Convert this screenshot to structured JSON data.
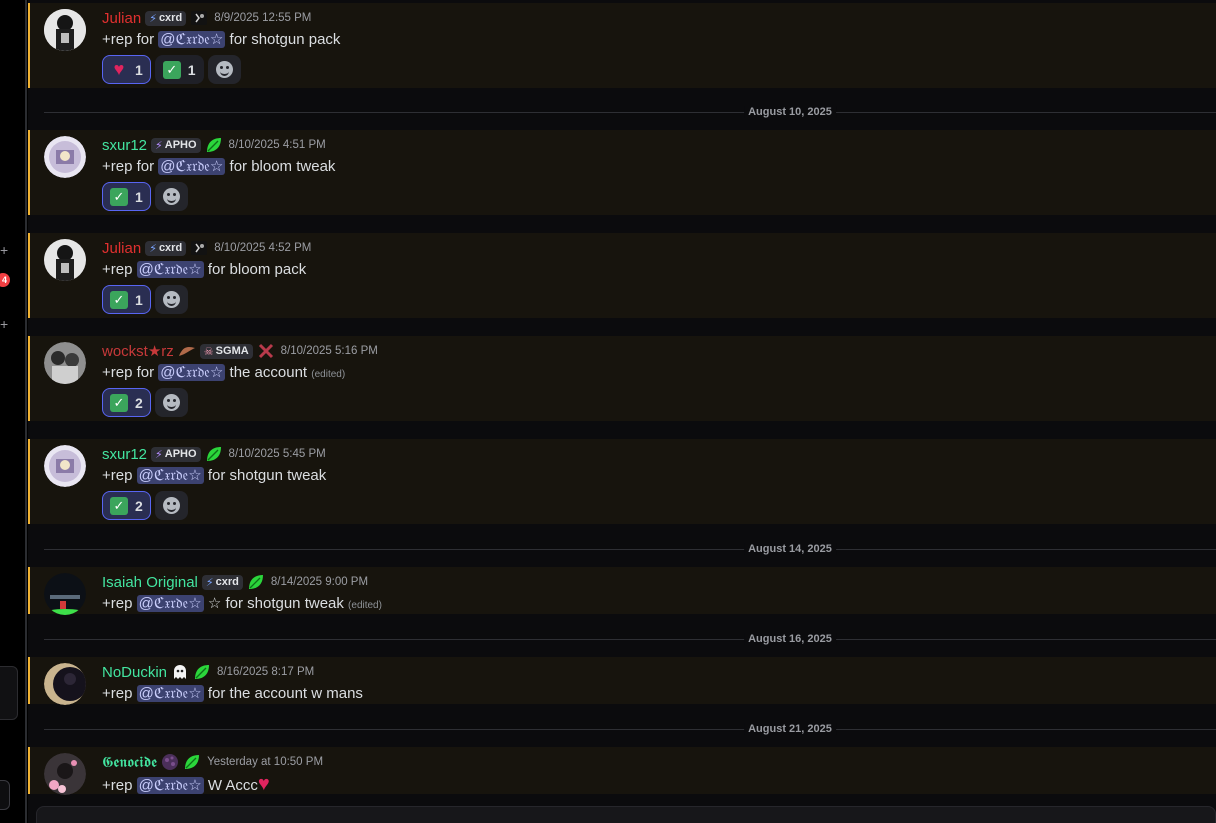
{
  "colors": {
    "julian": "#e0302f",
    "sxur": "#43e5a0",
    "wockst": "#c7393a",
    "isaiah": "#43e5a0",
    "noduckin": "#43e5a0",
    "genocide": "#43e5a0",
    "mention_bg": "#3c4270",
    "highlight_border": "#f0b232"
  },
  "dividers": [
    {
      "label": "August 10, 2025"
    },
    {
      "label": "August 14, 2025"
    },
    {
      "label": "August 16, 2025"
    },
    {
      "label": "August 21, 2025"
    }
  ],
  "server_strip": {
    "unread_badge": "4"
  },
  "messages": [
    {
      "username": "Julian",
      "tag": "cxrd",
      "timestamp": "8/9/2025 12:55 PM",
      "text_pre": "+rep for ",
      "mention": "@ℭ𝔵𝔯𝔡𝔢☆",
      "text_post": " for shotgun pack",
      "reactions": [
        {
          "emoji": "heart",
          "count": "1"
        },
        {
          "emoji": "check",
          "count": "1"
        }
      ]
    },
    {
      "username": "sxur12",
      "tag": "APHO",
      "timestamp": "8/10/2025 4:51 PM",
      "text_pre": "+rep for ",
      "mention": "@ℭ𝔵𝔯𝔡𝔢☆",
      "text_post": " for bloom tweak",
      "reactions": [
        {
          "emoji": "check",
          "count": "1"
        }
      ]
    },
    {
      "username": "Julian",
      "tag": "cxrd",
      "timestamp": "8/10/2025 4:52 PM",
      "text_pre": "+rep ",
      "mention": "@ℭ𝔵𝔯𝔡𝔢☆",
      "text_post": " for bloom pack",
      "reactions": [
        {
          "emoji": "check",
          "count": "1"
        }
      ]
    },
    {
      "username": "wockst★rz",
      "tag": "SGMA",
      "timestamp": "8/10/2025 5:16 PM",
      "text_pre": "+rep for ",
      "mention": "@ℭ𝔵𝔯𝔡𝔢☆",
      "text_post": " the account ",
      "edited": "(edited)",
      "reactions": [
        {
          "emoji": "check",
          "count": "2"
        }
      ]
    },
    {
      "username": "sxur12",
      "tag": "APHO",
      "timestamp": "8/10/2025 5:45 PM",
      "text_pre": "+rep ",
      "mention": "@ℭ𝔵𝔯𝔡𝔢☆",
      "text_post": " for shotgun tweak",
      "reactions": [
        {
          "emoji": "check",
          "count": "2"
        }
      ]
    },
    {
      "username": "Isaiah Original",
      "tag": "cxrd",
      "timestamp": "8/14/2025 9:00 PM",
      "text_pre": "+rep ",
      "mention": "@ℭ𝔵𝔯𝔡𝔢☆",
      "text_post": " ☆ for shotgun tweak ",
      "edited": "(edited)"
    },
    {
      "username": "NoDuckin",
      "timestamp": "8/16/2025 8:17 PM",
      "text_pre": "+rep ",
      "mention": "@ℭ𝔵𝔯𝔡𝔢☆",
      "text_post": " for the account w mans"
    },
    {
      "username": "𝕲𝖊𝖓𝖔𝖈𝖎𝖉𝖊",
      "timestamp": "Yesterday at 10:50 PM",
      "text_pre": "+rep ",
      "mention": "@ℭ𝔵𝔯𝔡𝔢☆",
      "text_post": " W Accc"
    }
  ]
}
